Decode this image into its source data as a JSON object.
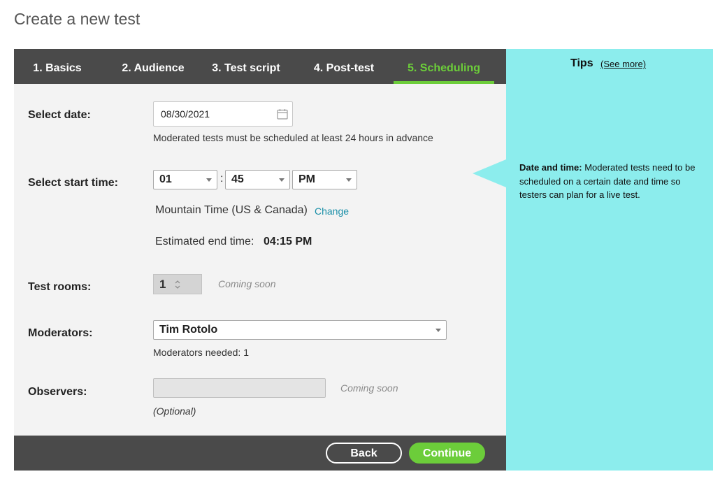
{
  "page": {
    "title": "Create a new test"
  },
  "tabs": [
    {
      "label": "1. Basics",
      "active": false
    },
    {
      "label": "2. Audience",
      "active": false
    },
    {
      "label": "3. Test script",
      "active": false
    },
    {
      "label": "4. Post-test",
      "active": false
    },
    {
      "label": "5. Scheduling",
      "active": true
    }
  ],
  "form": {
    "date": {
      "label": "Select date:",
      "value": "08/30/2021",
      "hint": "Moderated tests must be scheduled at least 24 hours in advance",
      "icon": "calendar-icon"
    },
    "start_time": {
      "label": "Select start time:",
      "hour": "01",
      "minute": "45",
      "separator": ":",
      "ampm": "PM",
      "timezone": "Mountain Time (US & Canada)",
      "change_link": "Change",
      "end_label": "Estimated end time:",
      "end_value": "04:15 PM"
    },
    "rooms": {
      "label": "Test rooms:",
      "value": "1",
      "note": "Coming soon"
    },
    "moderators": {
      "label": "Moderators:",
      "value": "Tim Rotolo",
      "needed": "Moderators needed: 1"
    },
    "observers": {
      "label": "Observers:",
      "value": "",
      "note": "Coming soon",
      "optional": "(Optional)"
    }
  },
  "footer": {
    "back_label": "Back",
    "continue_label": "Continue"
  },
  "tips": {
    "title": "Tips",
    "see_more": "(See more)",
    "heading": "Date and time:",
    "body": " Moderated tests need to be scheduled on a certain date and time so testers can plan for a live test."
  },
  "colors": {
    "accent_green": "#6ccd3a",
    "dark_bar": "#4a4a4a",
    "tips_bg": "#8ceded",
    "link": "#1a8fa8"
  }
}
